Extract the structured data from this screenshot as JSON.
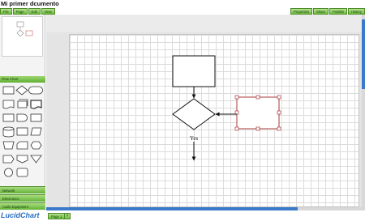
{
  "title": "Mi primer dcumento",
  "menu_left": [
    "File",
    "Page",
    "Edit",
    "View"
  ],
  "menu_right": [
    "Properties",
    "Share",
    "Publish",
    "History"
  ],
  "sidebar": {
    "section": "Flow Chart",
    "groups": [
      "Network",
      "Electronics",
      "Audio Equipment"
    ]
  },
  "diagram": {
    "decision_label": "Yes"
  },
  "footer": {
    "logo": "LucidChart",
    "page_tab": "Page 1",
    "add_page": "+"
  },
  "colors": {
    "accent_green": "#6fbf3f",
    "selection": "#a83a3a",
    "scroll_blue": "#3a7ac8"
  }
}
